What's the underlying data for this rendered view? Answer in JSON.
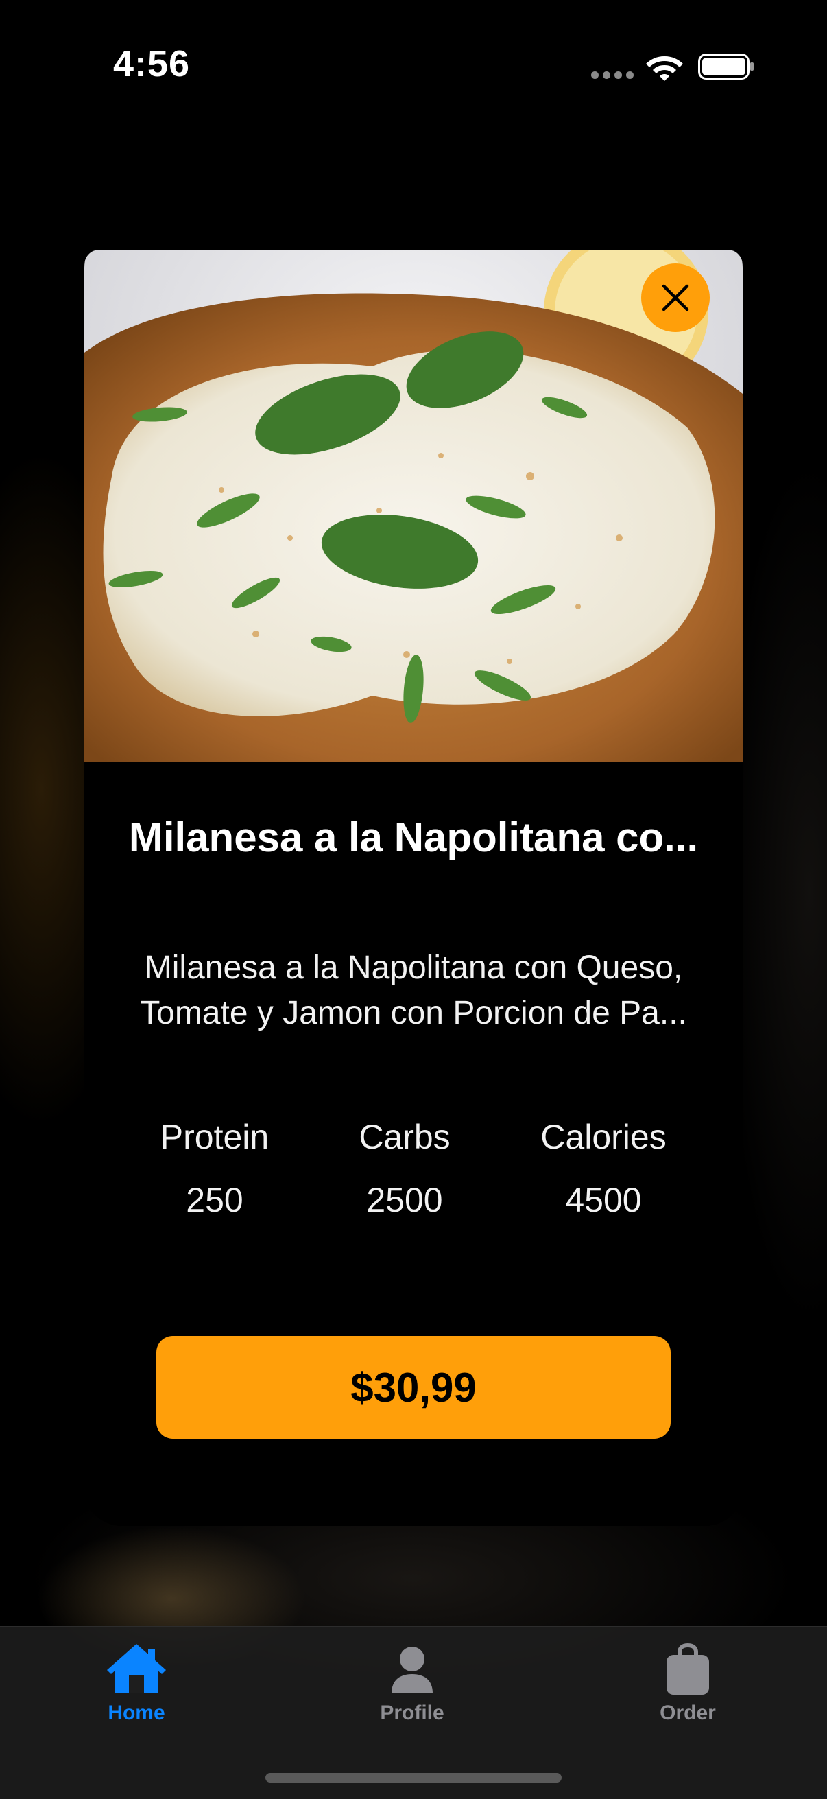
{
  "status_bar": {
    "time": "4:56",
    "icons": [
      "signal-dots-icon",
      "wifi-icon",
      "battery-icon"
    ]
  },
  "dish": {
    "image_icon": "milanesa-photo",
    "title": "Milanesa a la Napolitana co...",
    "description_line1": "Milanesa a la Napolitana con Queso,",
    "description_line2": "Tomate y Jamon con Porcion de Pa...",
    "nutrition": [
      {
        "label": "Protein",
        "value": "250"
      },
      {
        "label": "Carbs",
        "value": "2500"
      },
      {
        "label": "Calories",
        "value": "4500"
      }
    ],
    "price": "$30,99",
    "close_icon": "close-icon"
  },
  "tab_bar": {
    "tabs": [
      {
        "label": "Home",
        "icon": "house-icon",
        "active": true
      },
      {
        "label": "Profile",
        "icon": "person-icon",
        "active": false
      },
      {
        "label": "Order",
        "icon": "bag-icon",
        "active": false
      }
    ]
  },
  "colors": {
    "accent_orange": "#ff9f0a",
    "tab_active_blue": "#0a84ff",
    "tab_inactive_gray": "#8e8e93",
    "background": "#000000"
  }
}
